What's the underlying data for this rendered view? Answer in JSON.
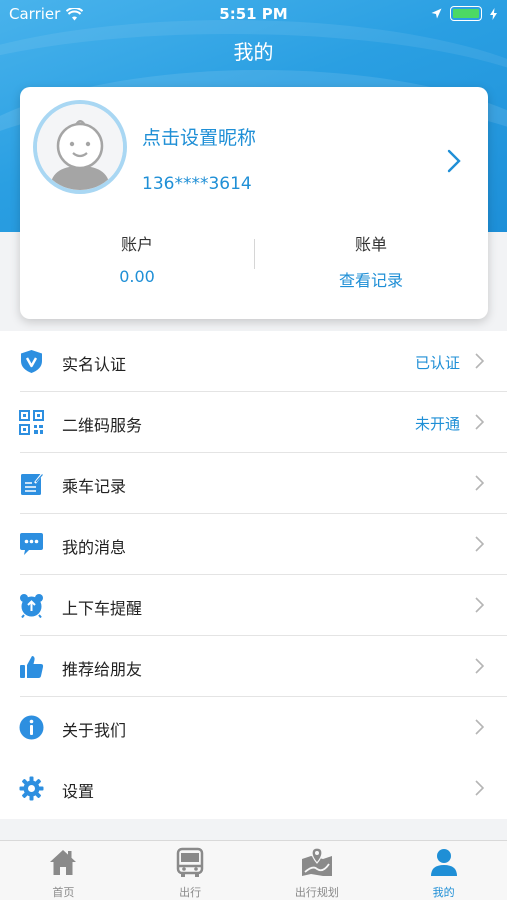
{
  "status_bar": {
    "carrier": "Carrier",
    "time": "5:51 PM"
  },
  "header": {
    "title": "我的"
  },
  "profile": {
    "nickname": "点击设置昵称",
    "phone": "136****3614",
    "account_label": "账户",
    "account_value": "0.00",
    "bill_label": "账单",
    "bill_value": "查看记录"
  },
  "menu": {
    "items": [
      {
        "label": "实名认证",
        "status": "已认证",
        "icon": "shield-v-icon"
      },
      {
        "label": "二维码服务",
        "status": "未开通",
        "icon": "qrcode-icon"
      },
      {
        "label": "乘车记录",
        "status": "",
        "icon": "edit-note-icon"
      },
      {
        "label": "我的消息",
        "status": "",
        "icon": "chat-bubble-icon"
      },
      {
        "label": "上下车提醒",
        "status": "",
        "icon": "alarm-clock-icon"
      },
      {
        "label": "推荐给朋友",
        "status": "",
        "icon": "thumbs-up-icon"
      },
      {
        "label": "关于我们",
        "status": "",
        "icon": "info-icon"
      },
      {
        "label": "设置",
        "status": "",
        "icon": "gear-icon"
      }
    ]
  },
  "tabbar": {
    "tabs": [
      {
        "label": "首页",
        "icon": "home-icon"
      },
      {
        "label": "出行",
        "icon": "bus-icon"
      },
      {
        "label": "出行规划",
        "icon": "map-icon"
      },
      {
        "label": "我的",
        "icon": "person-icon"
      }
    ],
    "active_index": 3
  },
  "colors": {
    "accent": "#1f8fd6",
    "header": "#2a9fe2",
    "icon_blue": "#2d8fe0"
  }
}
